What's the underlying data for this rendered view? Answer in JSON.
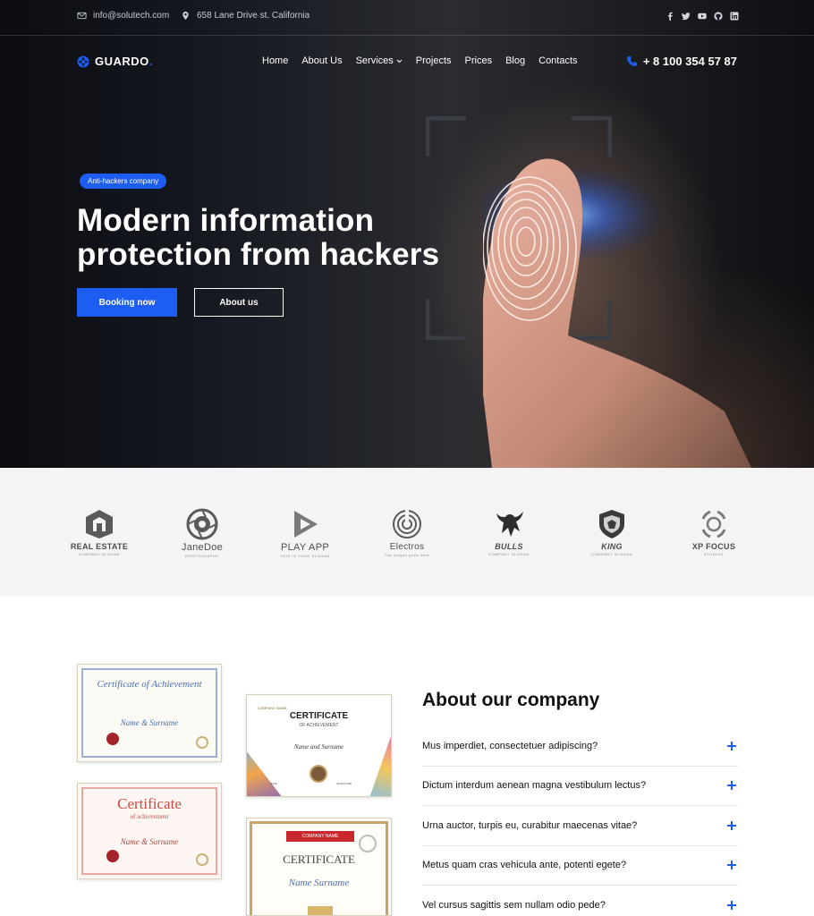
{
  "topbar": {
    "email": "info@solutech.com",
    "address": "658 Lane Drive st. California",
    "socials": [
      "facebook-icon",
      "twitter-icon",
      "youtube-icon",
      "github-icon",
      "linkedin-icon"
    ]
  },
  "header": {
    "logo_text": "GUARDO",
    "logo_dot": ".",
    "nav": [
      {
        "label": "Home"
      },
      {
        "label": "About Us"
      },
      {
        "label": "Services",
        "has_dropdown": true
      },
      {
        "label": "Projects"
      },
      {
        "label": "Prices"
      },
      {
        "label": "Blog"
      },
      {
        "label": "Contacts"
      }
    ],
    "phone": "+ 8 100 354 57 87"
  },
  "hero": {
    "badge": "Anti-hackers company",
    "title_line1": "Modern information",
    "title_line2": "protection from hackers",
    "primary_button": "Booking now",
    "secondary_button": "About us"
  },
  "clients": [
    {
      "name": "REAL ESTATE",
      "sub": "COMPANY SLOGAN",
      "icon": "building-icon"
    },
    {
      "name": "JaneDoe",
      "sub": "PHOTOGRAPHY",
      "icon": "camera-lens-icon"
    },
    {
      "name": "PLAY APP",
      "sub": "THIS IS YOUR SLOGAN",
      "icon": "play-icon"
    },
    {
      "name": "Electros",
      "sub": "The slogan goes here",
      "icon": "spiral-icon"
    },
    {
      "name": "BULLS",
      "sub": "COMPANY SLOGAN",
      "icon": "bull-icon"
    },
    {
      "name": "KING",
      "sub": "COMPANY SLOGAN",
      "icon": "lion-shield-icon"
    },
    {
      "name": "XP FOCUS",
      "sub": "STUDIOS",
      "icon": "focus-ring-icon"
    }
  ],
  "certificates": [
    {
      "heading": "Certificate of Achievement",
      "name": "Name & Surname",
      "accent": "#4a6fb0"
    },
    {
      "heading": "Certificate",
      "sub": "of achievement",
      "name": "Name & Surname",
      "accent": "#c94a42"
    },
    {
      "heading": "CERTIFICATE",
      "sub": "OF ACHIEVEMENT",
      "logo": "COMPANY NAME",
      "name": "Name and Surname",
      "labels": [
        "DATE",
        "SIGNATURE"
      ]
    },
    {
      "ribbon": "COMPANY NAME",
      "heading": "CERTIFICATE",
      "name": "Name Surname"
    }
  ],
  "about": {
    "title": "About our company",
    "faq": [
      "Mus imperdiet, consectetuer adipiscing?",
      "Dictum interdum aenean magna vestibulum lectus?",
      "Urna auctor, turpis eu, curabitur maecenas vitae?",
      "Metus quam cras vehicula ante, potenti egete?",
      "Vel cursus sagittis sem nullam odio pede?"
    ]
  },
  "colors": {
    "accent": "#1d5df2",
    "hero_dark": "#121419",
    "clients_bg": "#f4f4f5"
  }
}
